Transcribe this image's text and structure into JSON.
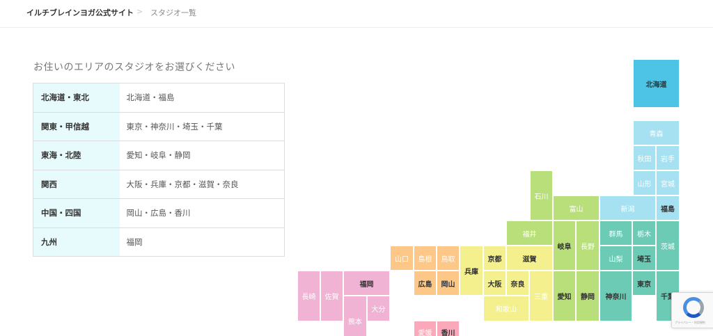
{
  "breadcrumb": {
    "home": "イルチブレインヨガ公式サイト",
    "separator": ">",
    "current": "スタジオ一覧"
  },
  "heading": "お住いのエリアのスタジオをお選びください",
  "areas": [
    {
      "name": "北海道・東北",
      "prefectures": "北海道・福島"
    },
    {
      "name": "関東・甲信越",
      "prefectures": "東京・神奈川・埼玉・千葉"
    },
    {
      "name": "東海・北陸",
      "prefectures": "愛知・岐阜・静岡"
    },
    {
      "name": "関西",
      "prefectures": "大阪・兵庫・京都・滋賀・奈良"
    },
    {
      "name": "中国・四国",
      "prefectures": "岡山・広島・香川"
    },
    {
      "name": "九州",
      "prefectures": "福岡"
    }
  ],
  "colors": {
    "hokkaido": "#4dc3e6",
    "tohoku": "#a6e1f2",
    "kanto": "#6ccbb4",
    "chubu": "#b8df7a",
    "kansai": "#f4f08e",
    "chugoku": "#fcc787",
    "shikoku": "#f9a9b9",
    "kyushu": "#f0b3d3"
  },
  "map": {
    "prefs": [
      {
        "key": "hokkaido",
        "label": "北海道",
        "region": "hokkaido",
        "active": true
      },
      {
        "key": "aomori",
        "label": "青森",
        "region": "tohoku",
        "active": false
      },
      {
        "key": "akita",
        "label": "秋田",
        "region": "tohoku",
        "active": false
      },
      {
        "key": "iwate",
        "label": "岩手",
        "region": "tohoku",
        "active": false
      },
      {
        "key": "yamagata",
        "label": "山形",
        "region": "tohoku",
        "active": false
      },
      {
        "key": "miyagi",
        "label": "宮城",
        "region": "tohoku",
        "active": false
      },
      {
        "key": "fukushima",
        "label": "福島",
        "region": "tohoku",
        "active": true
      },
      {
        "key": "niigata",
        "label": "新潟",
        "region": "tohoku",
        "active": false
      },
      {
        "key": "toyama",
        "label": "富山",
        "region": "chubu",
        "active": false
      },
      {
        "key": "ishikawa",
        "label": "石川",
        "region": "chubu",
        "active": false
      },
      {
        "key": "fukui",
        "label": "福井",
        "region": "chubu",
        "active": false
      },
      {
        "key": "gifu",
        "label": "岐阜",
        "region": "chubu",
        "active": true
      },
      {
        "key": "nagano",
        "label": "長野",
        "region": "chubu",
        "active": false
      },
      {
        "key": "aichi",
        "label": "愛知",
        "region": "chubu",
        "active": true
      },
      {
        "key": "shizuoka",
        "label": "静岡",
        "region": "chubu",
        "active": true
      },
      {
        "key": "gunma",
        "label": "群馬",
        "region": "kanto",
        "active": false
      },
      {
        "key": "tochigi",
        "label": "栃木",
        "region": "kanto",
        "active": false
      },
      {
        "key": "ibaraki",
        "label": "茨城",
        "region": "kanto",
        "active": false
      },
      {
        "key": "yamanashi",
        "label": "山梨",
        "region": "kanto",
        "active": false
      },
      {
        "key": "saitama",
        "label": "埼玉",
        "region": "kanto",
        "active": true
      },
      {
        "key": "kanagawa",
        "label": "神奈川",
        "region": "kanto",
        "active": true
      },
      {
        "key": "tokyo",
        "label": "東京",
        "region": "kanto",
        "active": true
      },
      {
        "key": "chiba",
        "label": "千葉",
        "region": "kanto",
        "active": true
      },
      {
        "key": "kyoto",
        "label": "京都",
        "region": "kansai",
        "active": true
      },
      {
        "key": "shiga",
        "label": "滋賀",
        "region": "kansai",
        "active": true
      },
      {
        "key": "hyogo",
        "label": "兵庫",
        "region": "kansai",
        "active": true
      },
      {
        "key": "osaka",
        "label": "大阪",
        "region": "kansai",
        "active": true
      },
      {
        "key": "nara",
        "label": "奈良",
        "region": "kansai",
        "active": true
      },
      {
        "key": "mie",
        "label": "三重",
        "region": "kansai",
        "active": false
      },
      {
        "key": "wakayama",
        "label": "和歌山",
        "region": "kansai",
        "active": false
      },
      {
        "key": "yamaguchi",
        "label": "山口",
        "region": "chugoku",
        "active": false
      },
      {
        "key": "shimane",
        "label": "島根",
        "region": "chugoku",
        "active": false
      },
      {
        "key": "tottori",
        "label": "鳥取",
        "region": "chugoku",
        "active": false
      },
      {
        "key": "hiroshima",
        "label": "広島",
        "region": "chugoku",
        "active": true
      },
      {
        "key": "okayama",
        "label": "岡山",
        "region": "chugoku",
        "active": true
      },
      {
        "key": "ehime",
        "label": "愛媛",
        "region": "shikoku",
        "active": false
      },
      {
        "key": "kagawa",
        "label": "香川",
        "region": "shikoku",
        "active": true
      },
      {
        "key": "fukuoka",
        "label": "福岡",
        "region": "kyushu",
        "active": true
      },
      {
        "key": "nagasaki",
        "label": "長崎",
        "region": "kyushu",
        "active": false
      },
      {
        "key": "saga",
        "label": "佐賀",
        "region": "kyushu",
        "active": false
      },
      {
        "key": "oita",
        "label": "大分",
        "region": "kyushu",
        "active": false
      },
      {
        "key": "kumamoto",
        "label": "熊本",
        "region": "kyushu",
        "active": false
      }
    ]
  },
  "recaptcha": {
    "text": "プライバシー・利用規約"
  }
}
